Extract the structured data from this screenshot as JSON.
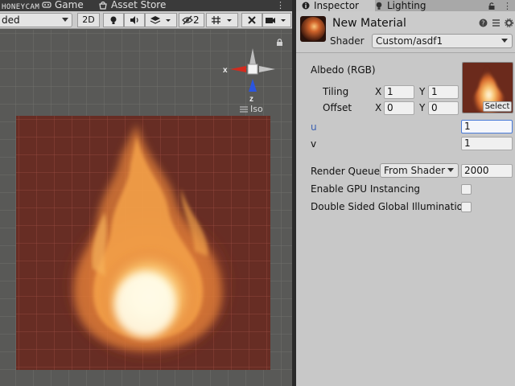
{
  "scene_tabs": {
    "watermark": "HONEYCAM",
    "game_label": "Game",
    "asset_store_label": "Asset Store"
  },
  "scene_toolbar": {
    "shading_mode": "ded",
    "mode_2d_label": "2D",
    "hidden_count": "2"
  },
  "scene_view": {
    "projection_label": "Iso",
    "gizmo_x_label": "x",
    "gizmo_z_label": "z"
  },
  "inspector_tabs": {
    "inspector_label": "Inspector",
    "lighting_label": "Lighting"
  },
  "material": {
    "name": "New Material",
    "shader_label": "Shader",
    "shader_value": "Custom/asdf1"
  },
  "properties": {
    "albedo_label": "Albedo (RGB)",
    "tiling_label": "Tiling",
    "tiling_x_label": "X",
    "tiling_x": "1",
    "tiling_y_label": "Y",
    "tiling_y": "1",
    "offset_label": "Offset",
    "offset_x_label": "X",
    "offset_x": "0",
    "offset_y_label": "Y",
    "offset_y": "0",
    "select_label": "Select",
    "u_label": "u",
    "u_value": "1",
    "v_label": "v",
    "v_value": "1"
  },
  "rendering": {
    "render_queue_label": "Render Queue",
    "render_queue_mode": "From Shader",
    "render_queue_value": "2000",
    "gpu_instancing_label": "Enable GPU Instancing",
    "gpu_instancing_checked": false,
    "double_sided_gi_label": "Double Sided Global Illumination",
    "double_sided_gi_checked": false
  },
  "colors": {
    "inspector_bg": "#c8c8c8",
    "scene_bg": "#5a5a58",
    "quad_tint": "#672d24",
    "focus_blue": "#4a7bd8",
    "gizmo_x_red": "#d22b1e",
    "gizmo_z_blue": "#2b55e0"
  }
}
